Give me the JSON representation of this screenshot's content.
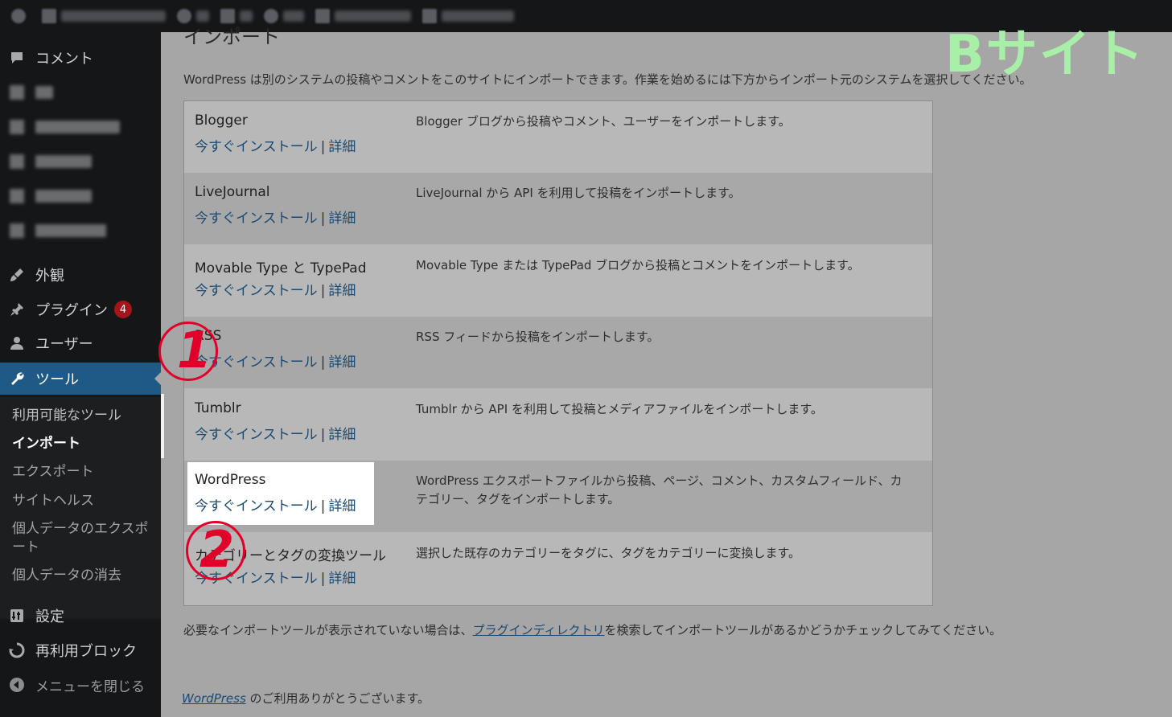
{
  "sidebar": {
    "items": [
      {
        "label": "コメント",
        "icon": "comment-icon"
      },
      {
        "label": "外観",
        "icon": "paintbrush-icon"
      },
      {
        "label": "プラグイン",
        "icon": "plugin-icon",
        "badge": "4"
      },
      {
        "label": "ユーザー",
        "icon": "user-icon"
      },
      {
        "label": "ツール",
        "icon": "wrench-icon"
      },
      {
        "label": "設定",
        "icon": "settings-icon"
      },
      {
        "label": "再利用ブロック",
        "icon": "reusable-block-icon"
      },
      {
        "label": "メニューを閉じる",
        "icon": "collapse-icon"
      }
    ],
    "submenu": [
      "利用可能なツール",
      "インポート",
      "エクスポート",
      "サイトヘルス",
      "個人データのエクスポート",
      "個人データの消去"
    ]
  },
  "main": {
    "title": "インポート",
    "intro": "WordPress は別のシステムの投稿やコメントをこのサイトにインポートできます。作業を始めるには下方からインポート元のシステムを選択してください。",
    "install_label": "今すぐインストール",
    "details_label": "詳細",
    "separator": "|",
    "importers": [
      {
        "name": "Blogger",
        "desc": "Blogger ブログから投稿やコメント、ユーザーをインポートします。"
      },
      {
        "name": "LiveJournal",
        "desc": "LiveJournal から API を利用して投稿をインポートします。"
      },
      {
        "name": "Movable Type と TypePad",
        "desc": "Movable Type または TypePad ブログから投稿とコメントをインポートします。"
      },
      {
        "name": "RSS",
        "desc": "RSS フィードから投稿をインポートします。"
      },
      {
        "name": "Tumblr",
        "desc": "Tumblr から API を利用して投稿とメディアファイルをインポートします。"
      },
      {
        "name": "WordPress",
        "desc": "WordPress エクスポートファイルから投稿、ページ、コメント、カスタムフィールド、カテゴリー、タグをインポートします。"
      },
      {
        "name": "カテゴリーとタグの変換ツール",
        "desc": "選択した既存のカテゴリーをタグに、タグをカテゴリーに変換します。"
      }
    ],
    "footer_before": "必要なインポートツールが表示されていない場合は、",
    "footer_link": "プラグインディレクトリ",
    "footer_after": "を検索してインポートツールがあるかどうかチェックしてみてください。",
    "thanks_link": "WordPress",
    "thanks_text": " のご利用ありがとうございます。"
  },
  "annotations": {
    "step1": "1",
    "step2": "2",
    "brand": "Bサイト",
    "color": "#e0002a",
    "brand_color": "#a8f0a8"
  }
}
